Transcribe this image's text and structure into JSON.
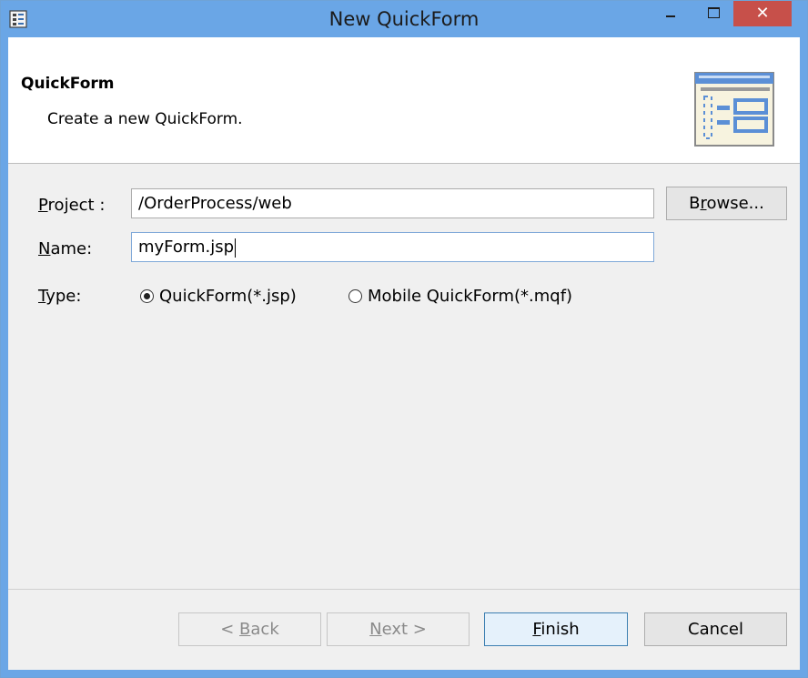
{
  "window": {
    "title": "New QuickForm",
    "controls": {
      "close_glyph": "✕"
    }
  },
  "header": {
    "title": "QuickForm",
    "subtitle": "Create a new QuickForm."
  },
  "form": {
    "project_label_mnemonic": "P",
    "project_label_rest": "roject :",
    "project_value": "/OrderProcess/web",
    "browse_prefix": "B",
    "browse_mnemonic": "r",
    "browse_rest": "owse...",
    "name_label_mnemonic": "N",
    "name_label_rest": "ame:",
    "name_value": "myForm.jsp",
    "type_label_mnemonic": "T",
    "type_label_rest": "ype:",
    "type_options": [
      {
        "label": "QuickForm(*.jsp)",
        "selected": true
      },
      {
        "label": "Mobile QuickForm(*.mqf)",
        "selected": false
      }
    ]
  },
  "footer": {
    "back_prefix": "< ",
    "back_mnemonic": "B",
    "back_rest": "ack",
    "next_mnemonic": "N",
    "next_rest": "ext >",
    "finish_mnemonic": "F",
    "finish_rest": "inish",
    "cancel_label": "Cancel"
  },
  "colors": {
    "titlebar": "#6aa6e6",
    "close_button": "#c7504a",
    "default_button_border": "#3c7fb1"
  },
  "icons": [
    "app-icon",
    "minimize-icon",
    "maximize-icon",
    "close-icon",
    "form-layout-icon"
  ]
}
